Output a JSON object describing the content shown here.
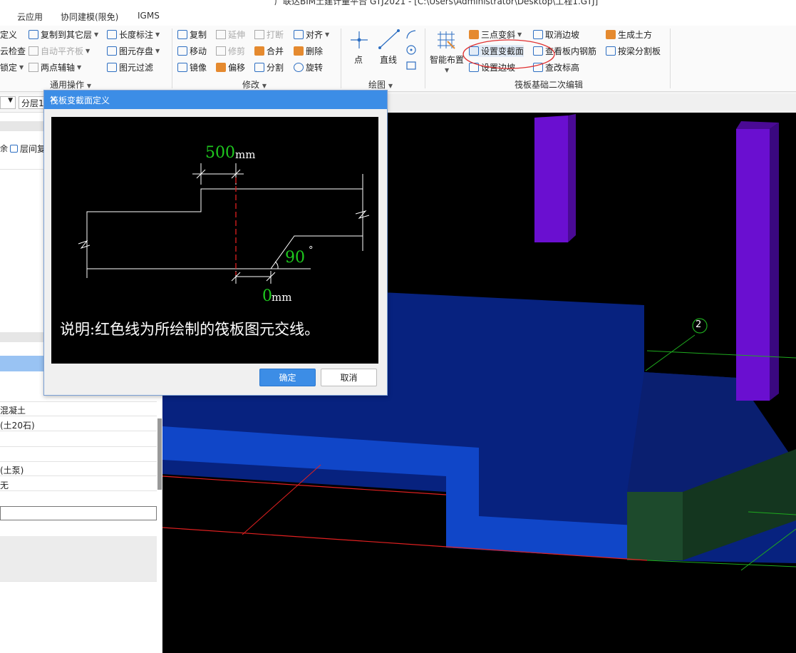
{
  "window": {
    "title": "广联达BIM土建计量平台 GTJ2021 - [C:\\Users\\Administrator\\Desktop\\工程1.GTJ]"
  },
  "menu": {
    "items": [
      "云应用",
      "协同建模(限免)",
      "IGMS"
    ]
  },
  "ribbon": {
    "general": {
      "items": [
        "定义",
        "复制到其它层",
        "长度标注",
        "云检查",
        "自动平齐板",
        "图元存盘",
        "锁定",
        "两点辅轴",
        "图元过滤"
      ],
      "label": "通用操作"
    },
    "modify": {
      "items": [
        "复制",
        "延伸",
        "打断",
        "对齐",
        "移动",
        "修剪",
        "合并",
        "删除",
        "镜像",
        "偏移",
        "分割",
        "旋转"
      ],
      "label": "修改"
    },
    "draw": {
      "items": [
        "点",
        "直线"
      ],
      "label": "绘图"
    },
    "raft": {
      "smart_layout": "智能布置",
      "items": [
        "三点变斜",
        "取消边坡",
        "生成土方",
        "设置变截面",
        "查看板内钢筋",
        "按梁分割板",
        "设置边坡",
        "查改标高"
      ],
      "label": "筏板基础二次编辑"
    }
  },
  "left_panel": {
    "floor_select": "分层1",
    "toolbar_item": "层间复",
    "rows": [
      "混凝土",
      "(土20石)",
      "(土泵)",
      "无"
    ]
  },
  "dialog": {
    "title": "筏板变截面定义",
    "close": "×",
    "dim_top_value": "500",
    "dim_top_unit": "mm",
    "angle_value": "90",
    "angle_unit": "°",
    "dim_bottom_value": "0",
    "dim_bottom_unit": "mm",
    "note": "说明:红色线为所绘制的筏板图元交线。",
    "ok": "确定",
    "cancel": "取消"
  },
  "viewport": {
    "axis_label": "2"
  },
  "colors": {
    "accent": "#3c8de6",
    "dim_green": "#1ec81e",
    "cut_red": "#e02020",
    "raft_blue": "#0a2a8c",
    "column_purple": "#6a0fd0"
  }
}
